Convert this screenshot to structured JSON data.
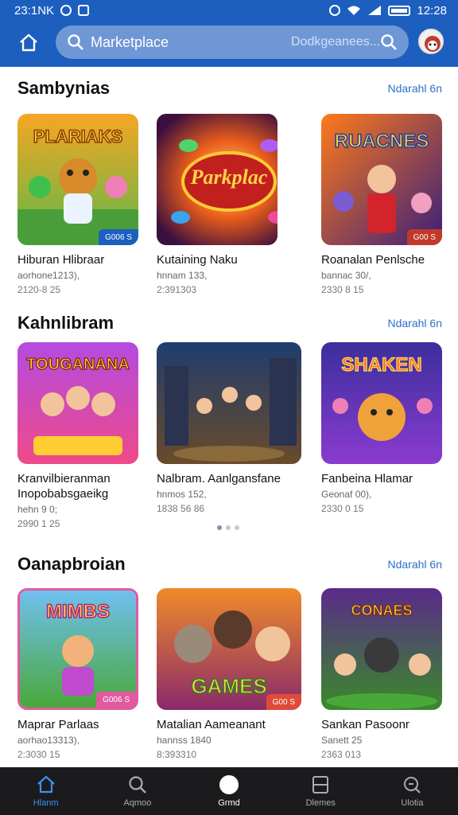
{
  "status": {
    "left_text": "23:1NK",
    "time": "12:28"
  },
  "header": {
    "title": "Marketplace",
    "placeholder": "Dodkgeanees..."
  },
  "sections": [
    {
      "title": "Sambynias",
      "see_all": "Ndarahl 6n",
      "items": [
        {
          "name": "Hiburan Hlibraar",
          "sub": "aorhone1213),",
          "meta": "2120-8 25",
          "badge": "G006 S"
        },
        {
          "name": "Kutaining Naku",
          "sub": "hnnam 133,",
          "meta": "2:391303",
          "badge": ""
        },
        {
          "name": "Roanalan Penlsche",
          "sub": "bannac 30/,",
          "meta": "2330 8 15",
          "badge": "G00 S"
        }
      ]
    },
    {
      "title": "Kahnlibram",
      "see_all": "Ndarahl 6n",
      "items": [
        {
          "name": "Kranvilbieranman",
          "name2": "Inopobabsgaeikg",
          "sub": "hehn 9 0;",
          "meta": "2990 1 25",
          "badge": ""
        },
        {
          "name": "Nalbram. Aanlgansfane",
          "sub": "hnmos 152,",
          "meta": "1838 56 86",
          "badge": ""
        },
        {
          "name": "Fanbeina Hlamar",
          "sub": "Geonaf 00),",
          "meta": "2330 0 15",
          "badge": ""
        }
      ]
    },
    {
      "title": "Oanapbroian",
      "see_all": "Ndarahl 6n",
      "items": [
        {
          "name": "Maprar Parlaas",
          "sub": "aorhao13313),",
          "meta": "2:3030 15",
          "badge": "G006 S"
        },
        {
          "name": "Matalian Aameanant",
          "sub": "hannss 1840",
          "meta": "8:393310",
          "badge": "G00 S"
        },
        {
          "name": "Sankan Pasoonr",
          "sub": "Sanett 25",
          "meta": "2363 013",
          "badge": ""
        }
      ]
    }
  ],
  "bottom_nav": [
    {
      "label": "Hlanm",
      "icon": "home-icon",
      "active": true
    },
    {
      "label": "Aqmoo",
      "icon": "search-icon",
      "active": false
    },
    {
      "label": "Grmd",
      "icon": "circle-icon",
      "active": false
    },
    {
      "label": "Dlemes",
      "icon": "box-icon",
      "active": false
    },
    {
      "label": "Ulotia",
      "icon": "chat-search-icon",
      "active": false
    }
  ],
  "colors": {
    "header": "#1d5fbf",
    "accent": "#3f8ff0",
    "link": "#2c6fca"
  },
  "thumb_titles": [
    "PLARIAKS",
    "Parkplac",
    "RUACNES",
    "TOUGANANA",
    "",
    "SHAKEN",
    "MIMBS",
    "GAMES",
    "CONAES"
  ]
}
